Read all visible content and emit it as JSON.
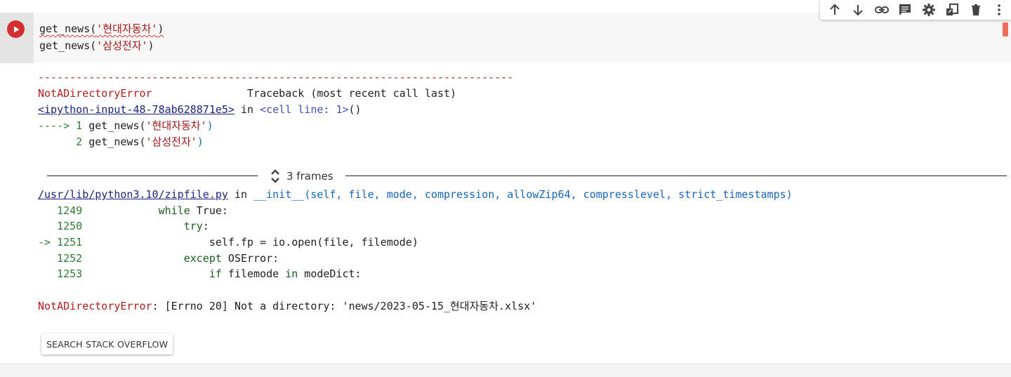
{
  "code": {
    "line1": {
      "fn": "get_news(",
      "arg": "'현대자동차'",
      "close": ")"
    },
    "line2": {
      "fn": "get_news(",
      "arg": "'삼성전자'",
      "close": ")"
    }
  },
  "output": {
    "dashes": "---------------------------------------------------------------------------",
    "error_name": "NotADirectoryError",
    "traceback_label": "Traceback (most recent call last)",
    "input_link": "<ipython-input-48-78ab628871e5>",
    "in_word": "in",
    "cell_ref": "<cell line: 1>",
    "cell_ref_paren": "()",
    "tb_lines": [
      {
        "prefix": "----> 1 ",
        "fn": "get_news(",
        "arg": "'현대자동차'",
        "close": ")"
      },
      {
        "prefix": "      2 ",
        "fn": "get_news(",
        "arg": "'삼성전자'",
        "close": ")"
      }
    ],
    "frames_label": "3 frames",
    "file_link": "/usr/lib/python3.10/zipfile.py",
    "file_in_word": "in",
    "file_func": "__init__",
    "file_args": "(self, file, mode, compression, allowZip64, compresslevel, strict_timestamps)",
    "src_lines": [
      {
        "prefix": "   1249 ",
        "indent": "           ",
        "kw": "while",
        "rest": " True:"
      },
      {
        "prefix": "   1250 ",
        "indent": "               ",
        "kw": "try",
        "rest": ":"
      },
      {
        "prefix": "-> 1251 ",
        "indent": "                   ",
        "kw": "",
        "rest": "self.fp = io.open(file, filemode)"
      },
      {
        "prefix": "   1252 ",
        "indent": "               ",
        "kw": "except",
        "rest": " OSError:"
      },
      {
        "prefix": "   1253 ",
        "indent": "                   ",
        "kw": "if",
        "rest": " filemode ",
        "kw2": "in",
        "rest2": " modeDict:"
      }
    ],
    "final_error_name": "NotADirectoryError",
    "final_error_msg": ": [Errno 20] Not a directory: 'news/2023-05-15_현대자동차.xlsx'",
    "so_button": "SEARCH STACK OVERFLOW"
  },
  "toolbar": {
    "icons": [
      "arrow-up-icon",
      "arrow-down-icon",
      "link-icon",
      "comment-icon",
      "gear-icon",
      "mirror-cell-icon",
      "trash-icon",
      "more-vert-icon"
    ]
  },
  "colors": {
    "run_button": "#d32f2f",
    "error": "#b71c1c",
    "line_numbers": "#2e7d32",
    "link": "#1a237e"
  }
}
